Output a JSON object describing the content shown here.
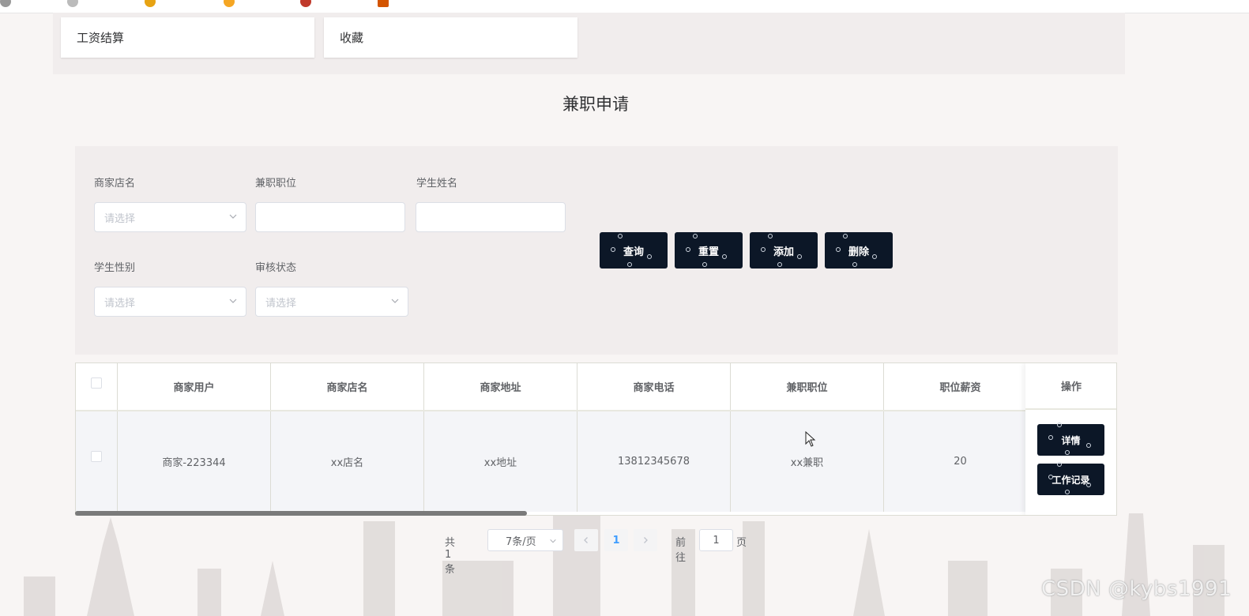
{
  "menu": {
    "cards": [
      {
        "label": "工资结算"
      },
      {
        "label": "收藏"
      }
    ]
  },
  "page": {
    "title": "兼职申请"
  },
  "search": {
    "fields": [
      {
        "label": "商家店名",
        "type": "select",
        "placeholder": "请选择",
        "value": ""
      },
      {
        "label": "兼职职位",
        "type": "input",
        "placeholder": "",
        "value": ""
      },
      {
        "label": "学生姓名",
        "type": "input",
        "placeholder": "",
        "value": ""
      },
      {
        "label": "学生性别",
        "type": "select",
        "placeholder": "请选择",
        "value": ""
      },
      {
        "label": "审核状态",
        "type": "select",
        "placeholder": "请选择",
        "value": ""
      }
    ],
    "buttons": {
      "query": "查询",
      "reset": "重置",
      "add": "添加",
      "delete": "删除"
    }
  },
  "table": {
    "columns": [
      "商家用户",
      "商家店名",
      "商家地址",
      "商家电话",
      "兼职职位",
      "职位薪资",
      "操作"
    ],
    "rows": [
      {
        "cells": [
          "商家-223344",
          "xx店名",
          "xx地址",
          "13812345678",
          "xx兼职",
          "20"
        ],
        "actions": {
          "detail": "详情",
          "work_record": "工作记录"
        }
      }
    ]
  },
  "pagination": {
    "total_text": "共 1 条",
    "page_size": "7条/页",
    "current_page": "1",
    "goto_prefix": "前往",
    "goto_value": "1",
    "goto_suffix": "页",
    "prev_icon": "chevron-left-icon",
    "next_icon": "chevron-right-icon"
  },
  "watermark": "CSDN @kybs1991",
  "colors": {
    "dark_button": "#0c1727",
    "accent": "#409eff",
    "panel": "#f1eded",
    "background": "#f8f5f4"
  }
}
